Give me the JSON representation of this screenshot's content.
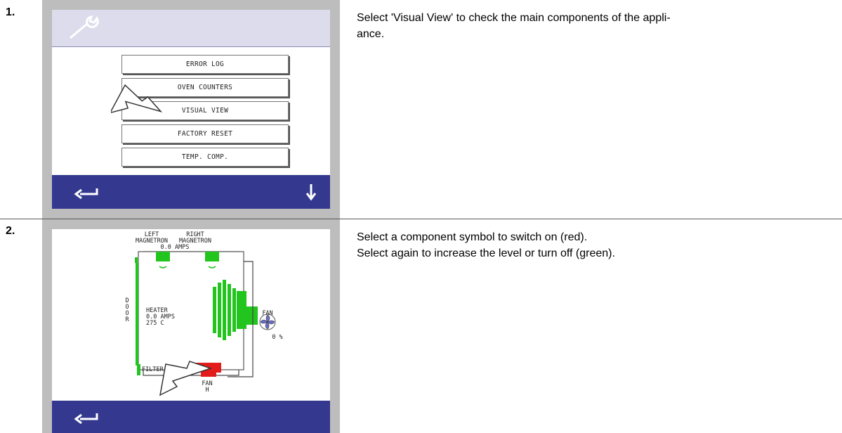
{
  "steps": [
    {
      "number": "1.",
      "description": "Select 'Visual View' to check the main components of the appli-ance.",
      "description_lines": [
        "Select 'Visual View' to check the main components of the appli-",
        "ance."
      ],
      "screen": {
        "header_icon": "wrench-icon",
        "menu_items": [
          "ERROR LOG",
          "OVEN COUNTERS",
          "VISUAL VIEW",
          "FACTORY RESET",
          "TEMP. COMP."
        ],
        "pointer": "arrow-pointer-icon",
        "footer_icons": [
          "back-arrow-icon",
          "down-arrow-icon"
        ]
      }
    },
    {
      "number": "2.",
      "description_lines": [
        "Select a component symbol to switch on (red).",
        "Select again to increase the level or turn off (green)."
      ],
      "screen": {
        "left_magnetron_label": [
          "LEFT",
          "MAGNETRON"
        ],
        "right_magnetron_label": [
          "RIGHT",
          "MAGNETRON"
        ],
        "magnetron_amps": "0.0 AMPS",
        "door_label": [
          "D",
          "O",
          "O",
          "R"
        ],
        "heater_lines": [
          "HEATER",
          "0.0 AMPS",
          "275  C"
        ],
        "fan_label": "FAN",
        "fan_percent": "0 %",
        "filter_label": "FILTER",
        "fan_h_label": [
          "FAN",
          "H"
        ],
        "colors": {
          "on": "#e41b1b",
          "off": "#22c51e"
        },
        "pointer": "arrow-pointer-icon",
        "footer_icons": [
          "back-arrow-icon"
        ]
      }
    }
  ]
}
